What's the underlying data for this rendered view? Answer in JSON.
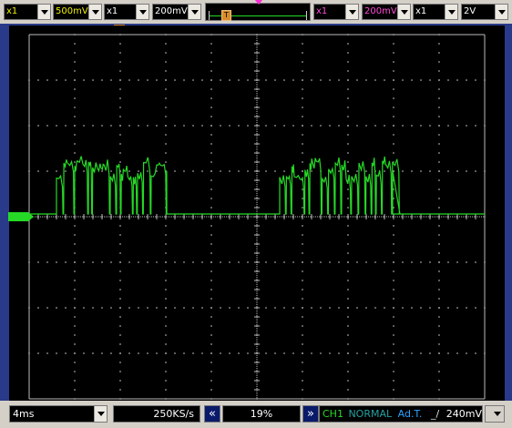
{
  "toolbar": {
    "ch1_probe": "x1",
    "ch1_volts": "500mV",
    "ch2_probe": "x1",
    "ch2_volts": "200mV",
    "ch3_probe": "x1",
    "ch3_volts": "200mV",
    "ch4_probe": "x1",
    "ch4_volts": "2V",
    "trigger_thumb_label": "T",
    "colors": {
      "ch1": "#f0f000",
      "ch2": "#ffffff",
      "ch3": "#ff4bd8",
      "ch4": "#ffffff"
    }
  },
  "screen": {
    "trace_color": "#26d926",
    "grid_color": "#bbbbbb",
    "background": "#000000"
  },
  "status": {
    "timebase": "4ms",
    "sample_rate": "250KS/s",
    "prev_icon": "double-chevron-left-icon",
    "position": "19%",
    "next_icon": "double-chevron-right-icon",
    "trig_source": "CH1",
    "trig_mode": "NORMAL",
    "trig_adjust": "Ad.T.",
    "trig_level": "240mV"
  }
}
